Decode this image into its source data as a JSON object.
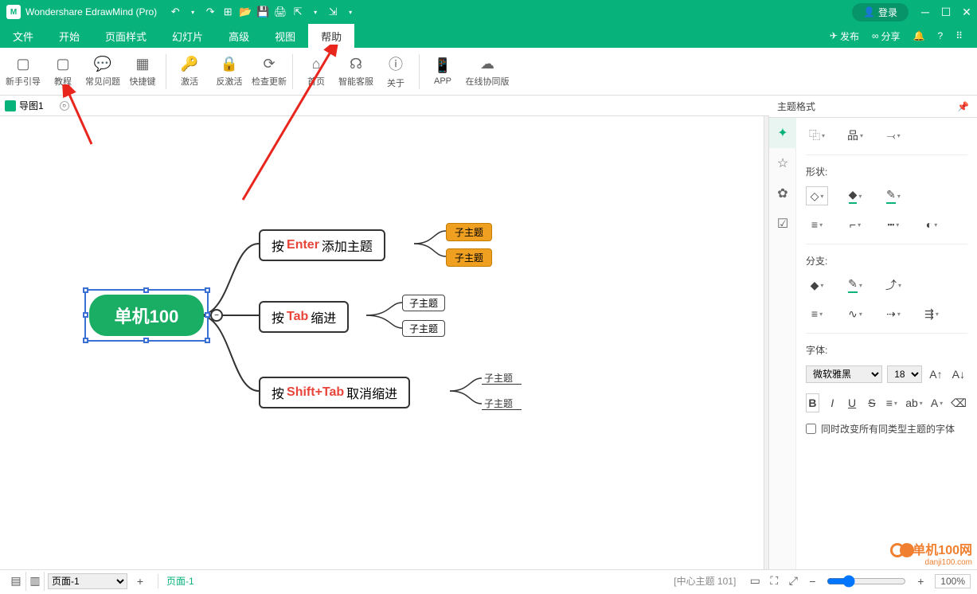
{
  "title": "Wondershare EdrawMind (Pro)",
  "login_label": "登录",
  "menubar": {
    "items": [
      "文件",
      "开始",
      "页面样式",
      "幻灯片",
      "高级",
      "视图",
      "帮助"
    ],
    "publish": "发布",
    "share": "分享"
  },
  "ribbon": {
    "items": [
      "新手引导",
      "教程",
      "常见问题",
      "快捷键",
      "激活",
      "反激活",
      "检查更新",
      "首页",
      "智能客服",
      "关于",
      "APP",
      "在线协同版"
    ]
  },
  "tab": {
    "name": "导图1"
  },
  "canvas": {
    "center": "单机100",
    "n1_pre": "按 ",
    "n1_kw": "Enter",
    "n1_post": " 添加主题",
    "n2_pre": "按 ",
    "n2_kw": "Tab",
    "n2_post": " 缩进",
    "n3_pre": "按 ",
    "n3_kw": "Shift+Tab",
    "n3_post": " 取消缩进",
    "sub": "子主题",
    "collapse": "−"
  },
  "rpanel": {
    "title": "主题格式",
    "shape_h": "形状:",
    "branch_h": "分支:",
    "font_h": "字体:",
    "font_name": "微软雅黑",
    "font_size": "18",
    "checkbox": "同时改变所有同类型主题的字体",
    "bold": "B",
    "italic": "I",
    "underline": "U",
    "strike": "S"
  },
  "statusbar": {
    "page_label": "页面-1",
    "page_tab": "页面-1",
    "hint": "[中心主题 101]",
    "zoom": "100%"
  },
  "watermark": {
    "brand": "单机100网",
    "url": "danji100.com"
  }
}
